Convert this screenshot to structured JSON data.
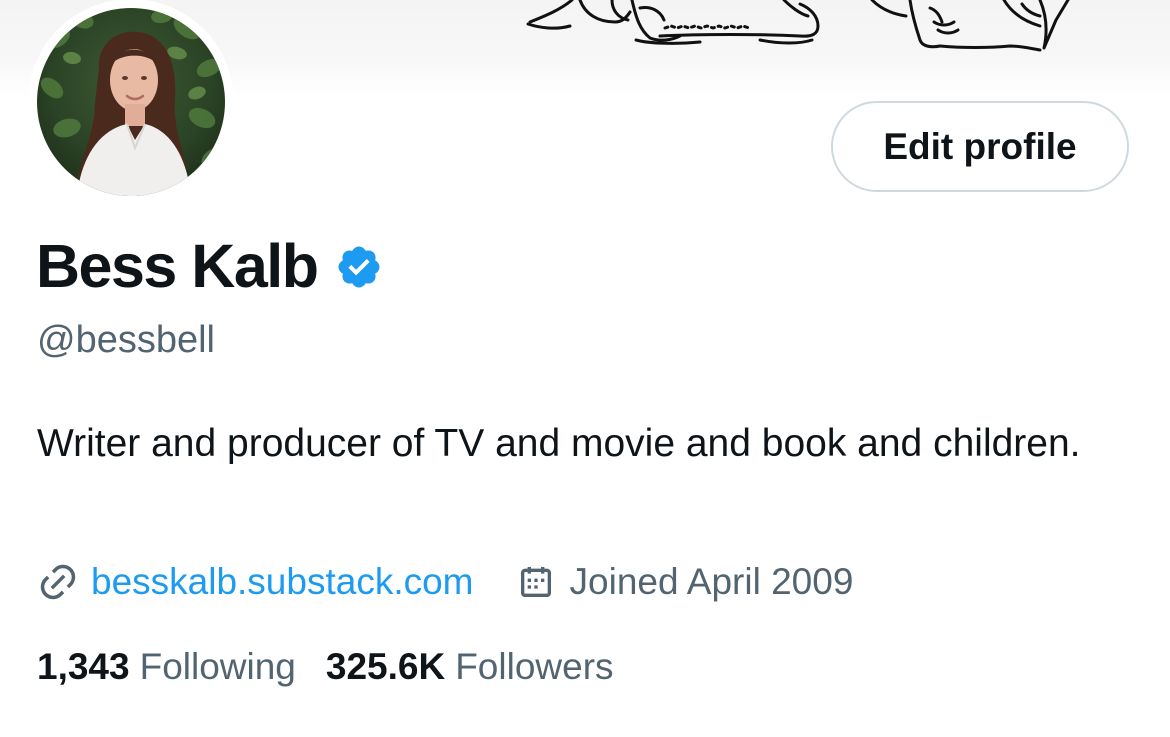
{
  "profile": {
    "display_name": "Bess Kalb",
    "handle": "@bessbell",
    "bio": "Writer and producer of TV and movie and book and children.",
    "website": "besskalb.substack.com",
    "joined": "Joined April 2009",
    "verified": true
  },
  "actions": {
    "edit_profile_label": "Edit profile"
  },
  "stats": {
    "following_count": "1,343",
    "following_label": "Following",
    "followers_count": "325.6K",
    "followers_label": "Followers"
  },
  "icons": {
    "verified": "verified-badge-icon",
    "link": "link-icon",
    "calendar": "calendar-icon"
  },
  "colors": {
    "accent": "#1d9bf0",
    "secondary_text": "#536471",
    "primary_text": "#0f1419",
    "button_border": "#cfd9de"
  }
}
